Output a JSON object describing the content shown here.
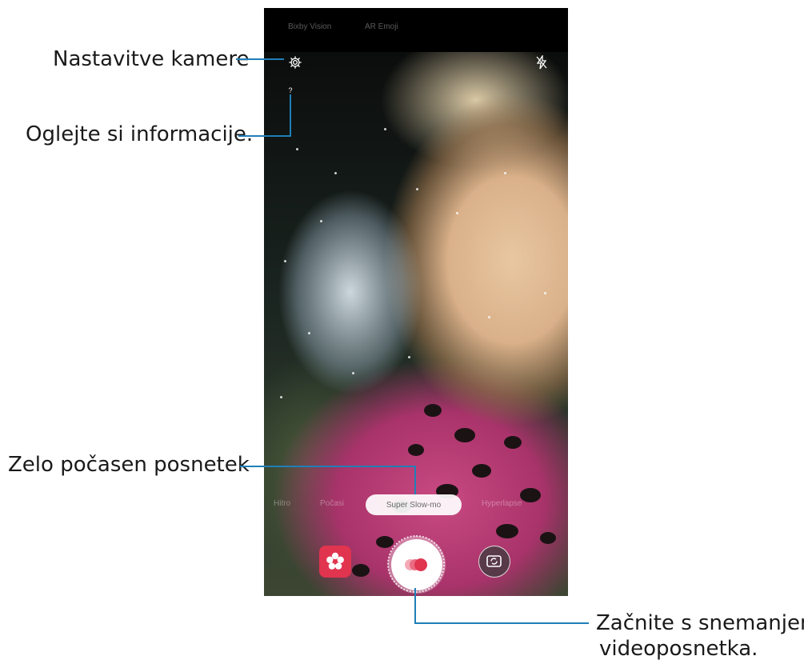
{
  "callouts": {
    "settings": "Nastavitve kamere",
    "info": "Oglejte si informacije.",
    "super_slow": "Zelo počasen posnetek",
    "record_line1": "Začnite s snemanjem",
    "record_line2": "videoposnetka."
  },
  "camera": {
    "top_modes": [
      "Bixby Vision",
      "AR Emoji"
    ],
    "info_glyph": "?",
    "bottom_modes": [
      "Hitro",
      "Počasi",
      "Super Slow-mo",
      "Hyperlapse"
    ],
    "selected_mode": "Super Slow-mo"
  },
  "icons": {
    "settings": "gear-icon",
    "flash": "flash-off-icon",
    "info": "info-icon",
    "gallery": "gallery-icon",
    "record": "record-slow-motion-icon",
    "switch": "switch-camera-icon"
  },
  "colors": {
    "leader_line": "#1f7fb8",
    "gallery_button": "#e0344f",
    "record_dots": "#e0344f"
  }
}
